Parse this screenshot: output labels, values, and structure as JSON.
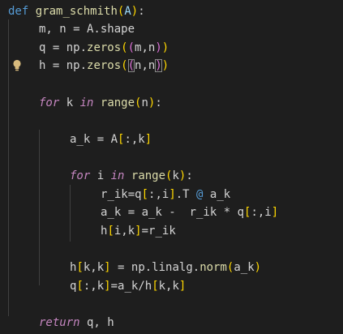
{
  "editor": {
    "lines": [
      {
        "indent": 0,
        "tokens": [
          {
            "t": "def",
            "c": "kw"
          },
          {
            "t": " "
          },
          {
            "t": "gram_schmith",
            "c": "fn"
          },
          {
            "t": "(",
            "c": "p1"
          },
          {
            "t": "A",
            "c": "var"
          },
          {
            "t": ")",
            "c": "p1"
          },
          {
            "t": ":"
          }
        ]
      },
      {
        "indent": 1,
        "tokens": [
          {
            "t": "m, n = A.shape"
          }
        ]
      },
      {
        "indent": 1,
        "tokens": [
          {
            "t": "q = np."
          },
          {
            "t": "zeros",
            "c": "fn"
          },
          {
            "t": "(",
            "c": "p1"
          },
          {
            "t": "(",
            "c": "p2"
          },
          {
            "t": "m,n"
          },
          {
            "t": ")",
            "c": "p2"
          },
          {
            "t": ")",
            "c": "p1"
          }
        ]
      },
      {
        "indent": 1,
        "bulb": true,
        "tokens": [
          {
            "t": "h = np."
          },
          {
            "t": "zeros",
            "c": "fn"
          },
          {
            "t": "(",
            "c": "p1"
          },
          {
            "t": "(",
            "c": "p2",
            "hl": true
          },
          {
            "t": "n,n"
          },
          {
            "t": ")",
            "c": "p2",
            "hl": true
          },
          {
            "t": ")",
            "c": "p1"
          }
        ]
      },
      {
        "indent": 0,
        "tokens": []
      },
      {
        "indent": 1,
        "tokens": [
          {
            "t": "for",
            "c": "ctl"
          },
          {
            "t": " k "
          },
          {
            "t": "in",
            "c": "ctl"
          },
          {
            "t": " "
          },
          {
            "t": "range",
            "c": "fn"
          },
          {
            "t": "(",
            "c": "p1"
          },
          {
            "t": "n"
          },
          {
            "t": ")",
            "c": "p1"
          },
          {
            "t": ":"
          }
        ]
      },
      {
        "indent": 0,
        "tokens": []
      },
      {
        "indent": 2,
        "tokens": [
          {
            "t": "a_k = A"
          },
          {
            "t": "[",
            "c": "p1"
          },
          {
            "t": ":,k"
          },
          {
            "t": "]",
            "c": "p1"
          }
        ]
      },
      {
        "indent": 0,
        "tokens": []
      },
      {
        "indent": 2,
        "tokens": [
          {
            "t": "for",
            "c": "ctl"
          },
          {
            "t": " i "
          },
          {
            "t": "in",
            "c": "ctl"
          },
          {
            "t": " "
          },
          {
            "t": "range",
            "c": "fn"
          },
          {
            "t": "(",
            "c": "p1"
          },
          {
            "t": "k"
          },
          {
            "t": ")",
            "c": "p1"
          },
          {
            "t": ":"
          }
        ]
      },
      {
        "indent": 3,
        "tokens": [
          {
            "t": "r_ik=q"
          },
          {
            "t": "[",
            "c": "p1"
          },
          {
            "t": ":,i"
          },
          {
            "t": "]",
            "c": "p1"
          },
          {
            "t": ".T "
          },
          {
            "t": "@",
            "c": "kw"
          },
          {
            "t": " a_k"
          }
        ]
      },
      {
        "indent": 3,
        "tokens": [
          {
            "t": "a_k = a_k -  r_ik * q"
          },
          {
            "t": "[",
            "c": "p1"
          },
          {
            "t": ":,i"
          },
          {
            "t": "]",
            "c": "p1"
          }
        ]
      },
      {
        "indent": 3,
        "tokens": [
          {
            "t": "h"
          },
          {
            "t": "[",
            "c": "p1"
          },
          {
            "t": "i,k"
          },
          {
            "t": "]",
            "c": "p1"
          },
          {
            "t": "=r_ik"
          }
        ]
      },
      {
        "indent": 0,
        "tokens": []
      },
      {
        "indent": 2,
        "tokens": [
          {
            "t": "h"
          },
          {
            "t": "[",
            "c": "p1"
          },
          {
            "t": "k,k"
          },
          {
            "t": "]",
            "c": "p1"
          },
          {
            "t": " = np.linalg."
          },
          {
            "t": "norm",
            "c": "fn"
          },
          {
            "t": "(",
            "c": "p1"
          },
          {
            "t": "a_k"
          },
          {
            "t": ")",
            "c": "p1"
          }
        ]
      },
      {
        "indent": 2,
        "tokens": [
          {
            "t": "q"
          },
          {
            "t": "[",
            "c": "p1"
          },
          {
            "t": ":,k"
          },
          {
            "t": "]",
            "c": "p1"
          },
          {
            "t": "=a_k/h"
          },
          {
            "t": "[",
            "c": "p1"
          },
          {
            "t": "k,k"
          },
          {
            "t": "]",
            "c": "p1"
          }
        ]
      },
      {
        "indent": 0,
        "tokens": []
      },
      {
        "indent": 1,
        "tokens": [
          {
            "t": "return",
            "c": "ctl"
          },
          {
            "t": " q, h"
          }
        ]
      }
    ]
  },
  "colors": {
    "background": "#1e1e1e",
    "default_text": "#d4d4d4",
    "keyword": "#569cd6",
    "control": "#c586c0",
    "function": "#dcdcaa",
    "bracket_1": "#ffd700",
    "bracket_2": "#da70d6",
    "lightbulb": "#d7ba7d"
  },
  "icons": {
    "gutter": "lightbulb-icon"
  }
}
